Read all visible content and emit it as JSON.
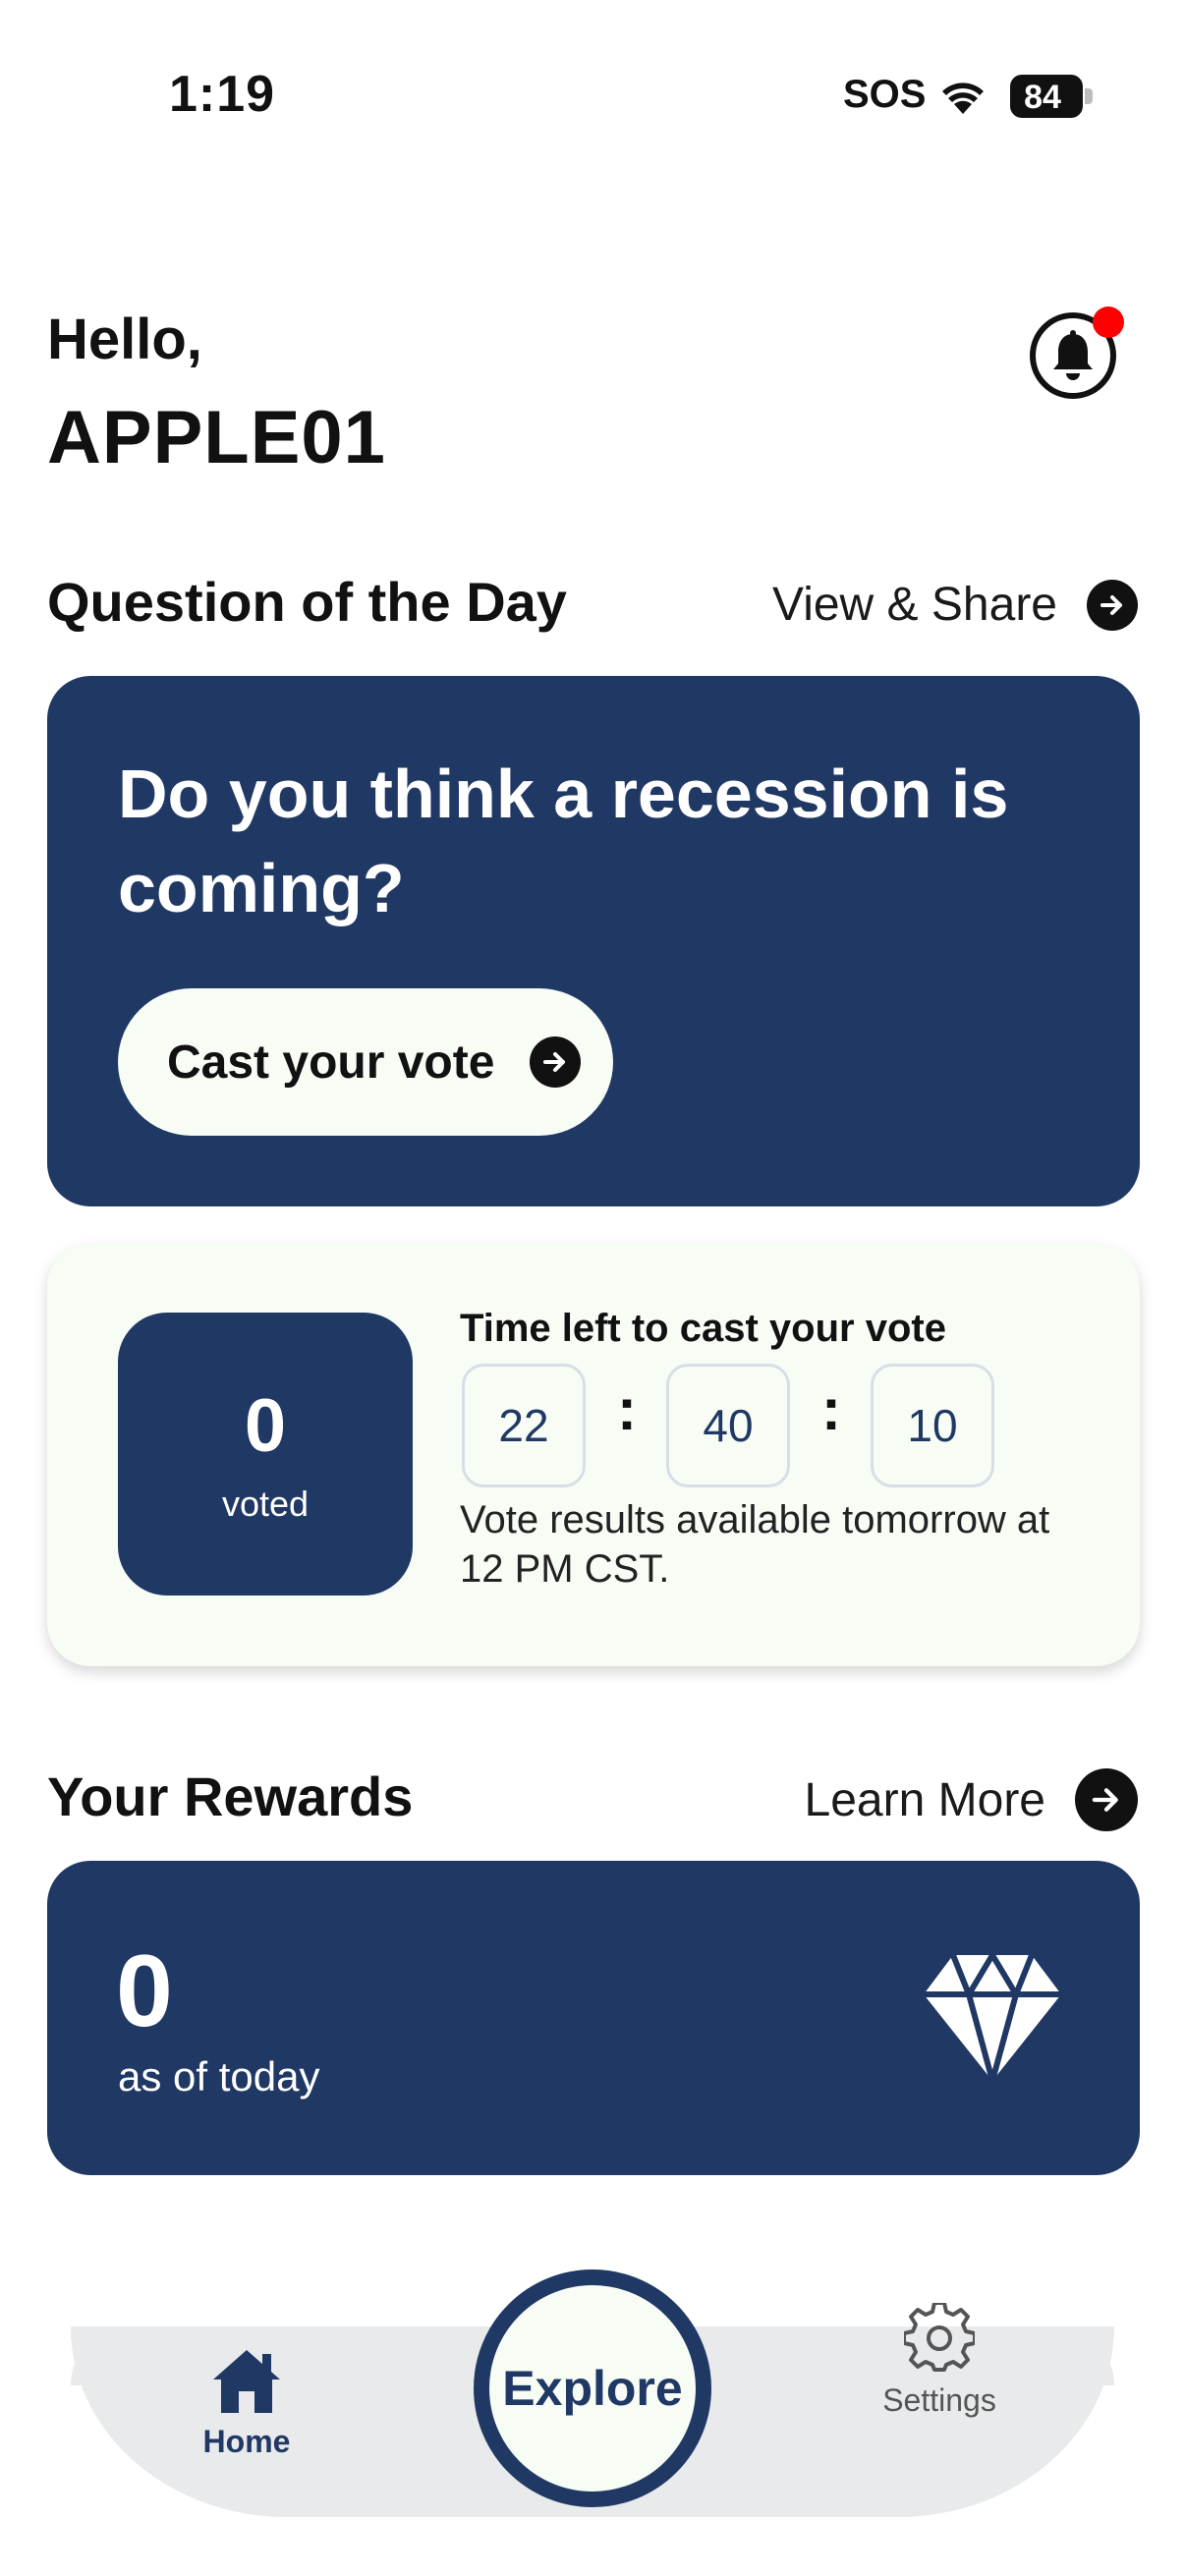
{
  "status_bar": {
    "time": "1:19",
    "sos": "SOS",
    "battery": "84"
  },
  "greeting": {
    "hello": "Hello,",
    "username": "APPLE01",
    "notification_badge_color": "#ff0000"
  },
  "question_section": {
    "title": "Question of the Day",
    "link_label": "View & Share",
    "question": "Do you think a recession is coming?",
    "vote_button": "Cast your vote"
  },
  "timer_card": {
    "voted_count": "0",
    "voted_label": "voted",
    "title": "Time left to cast your vote",
    "hours": "22",
    "minutes": "40",
    "seconds": "10",
    "separator": ":",
    "note": "Vote results available tomorrow at 12 PM  CST."
  },
  "rewards_section": {
    "title": "Your Rewards",
    "link_label": "Learn More",
    "amount": "0",
    "amount_label": "as of today",
    "icon": "diamond-icon"
  },
  "bottom_nav": {
    "home": "Home",
    "explore": "Explore",
    "settings": "Settings"
  },
  "colors": {
    "brand_navy": "#203864",
    "card_light": "#f7fcf5",
    "nav_bg": "#e9eaeb"
  }
}
